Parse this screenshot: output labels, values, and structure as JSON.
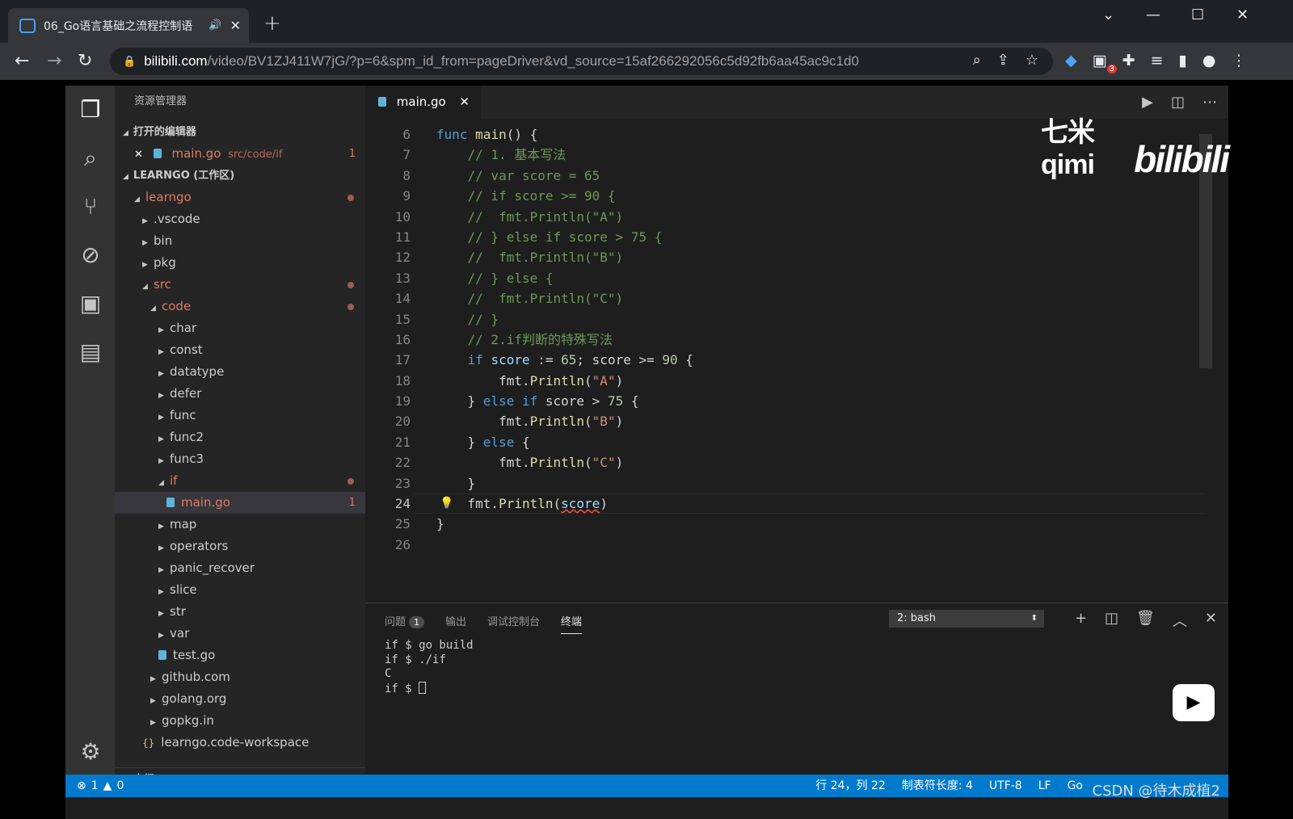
{
  "browser": {
    "tab_title": "06_Go语言基础之流程控制语",
    "speaker": "🔊",
    "close": "✕",
    "new_tab": "+",
    "url_domain": "bilibili.com",
    "url_path": "/video/BV1ZJ411W7jG/?p=6&spm_id_from=pageDriver&vd_source=15af266292056c5d92fb6aa45ac9c1d0",
    "extension_badge": "3"
  },
  "vscode": {
    "explorer_title": "资源管理器",
    "open_editors_title": "打开的编辑器",
    "open_editor": {
      "name": "main.go",
      "path": "src/code/if",
      "count": "1"
    },
    "workspace_title": "LEARNGO (工作区)",
    "tree": [
      {
        "label": "learngo",
        "indent": 1,
        "arrow": "◢",
        "modified": true,
        "dot": true
      },
      {
        "label": ".vscode",
        "indent": 2,
        "arrow": "▶"
      },
      {
        "label": "bin",
        "indent": 2,
        "arrow": "▶"
      },
      {
        "label": "pkg",
        "indent": 2,
        "arrow": "▶"
      },
      {
        "label": "src",
        "indent": 2,
        "arrow": "◢",
        "modified": true,
        "dot": true
      },
      {
        "label": "code",
        "indent": 3,
        "arrow": "◢",
        "modified": true,
        "dot": true
      },
      {
        "label": "char",
        "indent": 4,
        "arrow": "▶"
      },
      {
        "label": "const",
        "indent": 4,
        "arrow": "▶"
      },
      {
        "label": "datatype",
        "indent": 4,
        "arrow": "▶"
      },
      {
        "label": "defer",
        "indent": 4,
        "arrow": "▶"
      },
      {
        "label": "func",
        "indent": 4,
        "arrow": "▶"
      },
      {
        "label": "func2",
        "indent": 4,
        "arrow": "▶"
      },
      {
        "label": "func3",
        "indent": 4,
        "arrow": "▶"
      },
      {
        "label": "if",
        "indent": 4,
        "arrow": "◢",
        "modified": true,
        "dot": true
      },
      {
        "label": "main.go",
        "indent": 5,
        "file": "go",
        "modified": true,
        "selected": true,
        "count": "1"
      },
      {
        "label": "map",
        "indent": 4,
        "arrow": "▶"
      },
      {
        "label": "operators",
        "indent": 4,
        "arrow": "▶"
      },
      {
        "label": "panic_recover",
        "indent": 4,
        "arrow": "▶"
      },
      {
        "label": "slice",
        "indent": 4,
        "arrow": "▶"
      },
      {
        "label": "str",
        "indent": 4,
        "arrow": "▶"
      },
      {
        "label": "var",
        "indent": 4,
        "arrow": "▶"
      },
      {
        "label": "test.go",
        "indent": 4,
        "file": "go"
      },
      {
        "label": "github.com",
        "indent": 3,
        "arrow": "▶"
      },
      {
        "label": "golang.org",
        "indent": 3,
        "arrow": "▶"
      },
      {
        "label": "gopkg.in",
        "indent": 3,
        "arrow": "▶"
      },
      {
        "label": "learngo.code-workspace",
        "indent": 2,
        "file": "json"
      }
    ],
    "outline_title": "大纲",
    "editor_tab": "main.go",
    "code_lines": [
      {
        "n": "6",
        "html": "<span class=\"kw\">func</span> <span class=\"fn\">main</span>() {"
      },
      {
        "n": "7",
        "html": "    <span class=\"cmt\">// 1. 基本写法</span>"
      },
      {
        "n": "8",
        "html": "    <span class=\"cmt\">// var score = 65</span>"
      },
      {
        "n": "9",
        "html": "    <span class=\"cmt\">// if score >= 90 {</span>"
      },
      {
        "n": "10",
        "html": "    <span class=\"cmt\">//  fmt.Println(\"A\")</span>"
      },
      {
        "n": "11",
        "html": "    <span class=\"cmt\">// } else if score > 75 {</span>"
      },
      {
        "n": "12",
        "html": "    <span class=\"cmt\">//  fmt.Println(\"B\")</span>"
      },
      {
        "n": "13",
        "html": "    <span class=\"cmt\">// } else {</span>"
      },
      {
        "n": "14",
        "html": "    <span class=\"cmt\">//  fmt.Println(\"C\")</span>"
      },
      {
        "n": "15",
        "html": "    <span class=\"cmt\">// }</span>"
      },
      {
        "n": "16",
        "html": "    <span class=\"cmt\">// 2.if判断的特殊写法</span>"
      },
      {
        "n": "17",
        "html": "    <span class=\"kw\">if</span> <span class=\"var\">score</span> := <span class=\"num\">65</span>; score >= <span class=\"num\">90</span> {"
      },
      {
        "n": "18",
        "html": "        fmt.<span class=\"fn\">Println</span>(<span class=\"str\">\"A\"</span>)"
      },
      {
        "n": "19",
        "html": "    } <span class=\"kw\">else if</span> score > <span class=\"num\">75</span> {"
      },
      {
        "n": "20",
        "html": "        fmt.<span class=\"fn\">Println</span>(<span class=\"str\">\"B\"</span>)"
      },
      {
        "n": "21",
        "html": "    } <span class=\"kw\">else</span> {"
      },
      {
        "n": "22",
        "html": "        fmt.<span class=\"fn\">Println</span>(<span class=\"str\">\"C\"</span>)"
      },
      {
        "n": "23",
        "html": "    }"
      },
      {
        "n": "24",
        "html": "    fmt.<span class=\"fn\">Println</span>(<span class=\"squiggle var\">score</span>)",
        "current": true
      },
      {
        "n": "25",
        "html": "}"
      },
      {
        "n": "26",
        "html": ""
      }
    ],
    "watermark_name": "七米qimi",
    "watermark_logo": "bilibili",
    "panel": {
      "tabs": [
        "问题",
        "输出",
        "调试控制台",
        "终端"
      ],
      "problem_count": "1",
      "terminal_select": "2: bash",
      "terminal_lines": [
        "if $ go build",
        "if $ ./if",
        "C",
        "if $ "
      ]
    },
    "status": {
      "errors": "1",
      "warnings": "0",
      "position": "行 24，列 22",
      "tab_size": "制表符长度: 4",
      "encoding": "UTF-8",
      "eol": "LF",
      "language": "Go"
    },
    "credit": "CSDN @待木成植2"
  }
}
